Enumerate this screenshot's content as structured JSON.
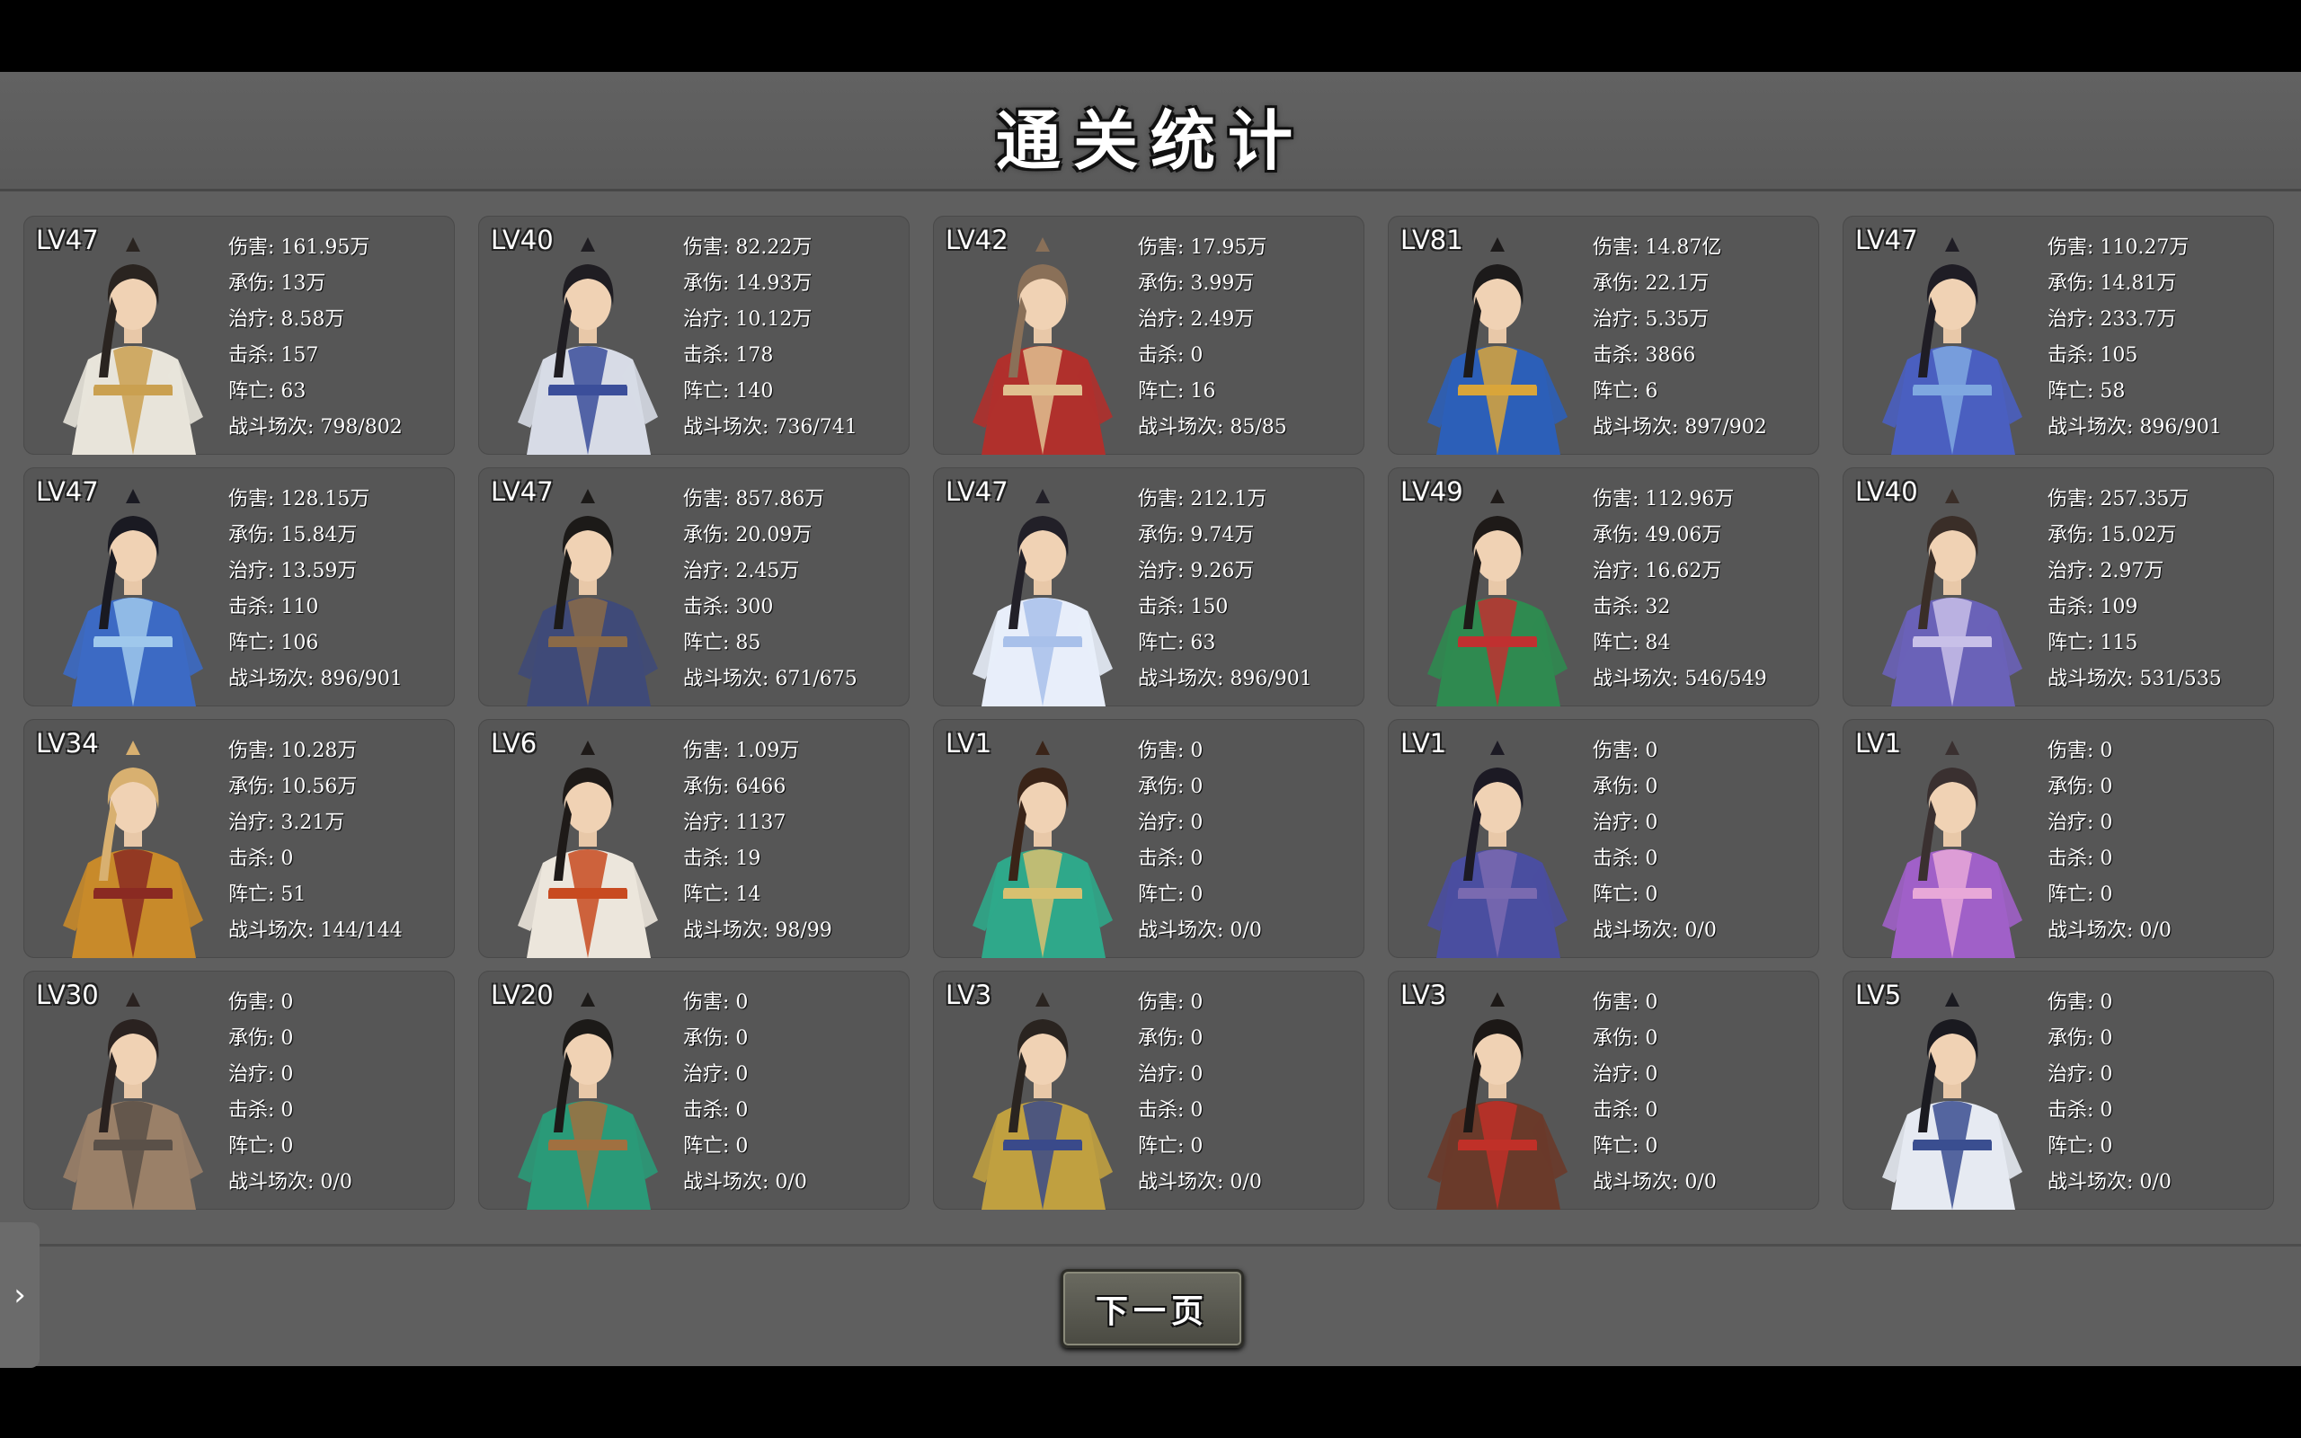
{
  "title": "通关统计",
  "next_page_label": "下一页",
  "side_tab_glyph": "›",
  "stat_labels": [
    "伤害",
    "承伤",
    "治疗",
    "击杀",
    "阵亡",
    "战斗场次"
  ],
  "cards": [
    {
      "level": "LV47",
      "stats": [
        "伤害: 161.95万",
        "承伤: 13万",
        "治疗: 8.58万",
        "击杀: 157",
        "阵亡: 63",
        "战斗场次: 798/802"
      ],
      "palette": {
        "robe": "#e8e4da",
        "accent": "#caa050",
        "hair": "#2a2420"
      }
    },
    {
      "level": "LV40",
      "stats": [
        "伤害: 82.22万",
        "承伤: 14.93万",
        "治疗: 10.12万",
        "击杀: 178",
        "阵亡: 140",
        "战斗场次: 736/741"
      ],
      "palette": {
        "robe": "#d7dbe6",
        "accent": "#3b4e9a",
        "hair": "#1f1d22"
      }
    },
    {
      "level": "LV42",
      "stats": [
        "伤害: 17.95万",
        "承伤: 3.99万",
        "治疗: 2.49万",
        "击杀: 0",
        "阵亡: 16",
        "战斗场次: 85/85"
      ],
      "palette": {
        "robe": "#b0302c",
        "accent": "#e0c090",
        "hair": "#8a7058"
      }
    },
    {
      "level": "LV81",
      "stats": [
        "伤害: 14.87亿",
        "承伤: 22.1万",
        "治疗: 5.35万",
        "击杀: 3866",
        "阵亡: 6",
        "战斗场次: 897/902"
      ],
      "palette": {
        "robe": "#2c5fb8",
        "accent": "#d9a53a",
        "hair": "#1c1a1a"
      }
    },
    {
      "level": "LV47",
      "stats": [
        "伤害: 110.27万",
        "承伤: 14.81万",
        "治疗: 233.7万",
        "击杀: 105",
        "阵亡: 58",
        "战斗场次: 896/901"
      ],
      "palette": {
        "robe": "#4a5fc0",
        "accent": "#7fa8e0",
        "hair": "#1f1d25"
      }
    },
    {
      "level": "LV47",
      "stats": [
        "伤害: 128.15万",
        "承伤: 15.84万",
        "治疗: 13.59万",
        "击杀: 110",
        "阵亡: 106",
        "战斗场次: 896/901"
      ],
      "palette": {
        "robe": "#3c6ac4",
        "accent": "#9fc8ec",
        "hair": "#1a1a22"
      }
    },
    {
      "level": "LV47",
      "stats": [
        "伤害: 857.86万",
        "承伤: 20.09万",
        "治疗: 2.45万",
        "击杀: 300",
        "阵亡: 85",
        "战斗场次: 671/675"
      ],
      "palette": {
        "robe": "#3f4a78",
        "accent": "#8a6a48",
        "hair": "#1c1a18"
      }
    },
    {
      "level": "LV47",
      "stats": [
        "伤害: 212.1万",
        "承伤: 9.74万",
        "治疗: 9.26万",
        "击杀: 150",
        "阵亡: 63",
        "战斗场次: 896/901"
      ],
      "palette": {
        "robe": "#e8eefa",
        "accent": "#a8c0ea",
        "hair": "#222028"
      }
    },
    {
      "level": "LV49",
      "stats": [
        "伤害: 112.96万",
        "承伤: 49.06万",
        "治疗: 16.62万",
        "击杀: 32",
        "阵亡: 84",
        "战斗场次: 546/549"
      ],
      "palette": {
        "robe": "#2f8a50",
        "accent": "#c03030",
        "hair": "#1e1a18"
      }
    },
    {
      "level": "LV40",
      "stats": [
        "伤害: 257.35万",
        "承伤: 15.02万",
        "治疗: 2.97万",
        "击杀: 109",
        "阵亡: 115",
        "战斗场次: 531/535"
      ],
      "palette": {
        "robe": "#6a62b8",
        "accent": "#c8c0e8",
        "hair": "#3a2e28"
      }
    },
    {
      "level": "LV34",
      "stats": [
        "伤害: 10.28万",
        "承伤: 10.56万",
        "治疗: 3.21万",
        "击杀: 0",
        "阵亡: 51",
        "战斗场次: 144/144"
      ],
      "palette": {
        "robe": "#c88a2a",
        "accent": "#8a2a22",
        "hair": "#d8b070"
      }
    },
    {
      "level": "LV6",
      "stats": [
        "伤害: 1.09万",
        "承伤: 6466",
        "治疗: 1137",
        "击杀: 19",
        "阵亡: 14",
        "战斗场次: 98/99"
      ],
      "palette": {
        "robe": "#ece6dc",
        "accent": "#c84a20",
        "hair": "#1e1a18"
      }
    },
    {
      "level": "LV1",
      "stats": [
        "伤害: 0",
        "承伤: 0",
        "治疗: 0",
        "击杀: 0",
        "阵亡: 0",
        "战斗场次: 0/0"
      ],
      "palette": {
        "robe": "#2fa88a",
        "accent": "#d8c070",
        "hair": "#3a2418"
      }
    },
    {
      "level": "LV1",
      "stats": [
        "伤害: 0",
        "承伤: 0",
        "治疗: 0",
        "击杀: 0",
        "阵亡: 0",
        "战斗场次: 0/0"
      ],
      "palette": {
        "robe": "#4a4ea0",
        "accent": "#7a6ab0",
        "hair": "#1c1a24"
      }
    },
    {
      "level": "LV1",
      "stats": [
        "伤害: 0",
        "承伤: 0",
        "治疗: 0",
        "击杀: 0",
        "阵亡: 0",
        "战斗场次: 0/0"
      ],
      "palette": {
        "robe": "#a060c8",
        "accent": "#e8a8d8",
        "hair": "#3a3030"
      }
    },
    {
      "level": "LV30",
      "stats": [
        "伤害: 0",
        "承伤: 0",
        "治疗: 0",
        "击杀: 0",
        "阵亡: 0",
        "战斗场次: 0/0"
      ],
      "palette": {
        "robe": "#9a8068",
        "accent": "#5a5048",
        "hair": "#2a2220"
      }
    },
    {
      "level": "LV20",
      "stats": [
        "伤害: 0",
        "承伤: 0",
        "治疗: 0",
        "击杀: 0",
        "阵亡: 0",
        "战斗场次: 0/0"
      ],
      "palette": {
        "robe": "#2a9a78",
        "accent": "#a07040",
        "hair": "#1c1a18"
      }
    },
    {
      "level": "LV3",
      "stats": [
        "伤害: 0",
        "承伤: 0",
        "治疗: 0",
        "击杀: 0",
        "阵亡: 0",
        "战斗场次: 0/0"
      ],
      "palette": {
        "robe": "#c0a040",
        "accent": "#3a4a8a",
        "hair": "#2a2420"
      }
    },
    {
      "level": "LV3",
      "stats": [
        "伤害: 0",
        "承伤: 0",
        "治疗: 0",
        "击杀: 0",
        "阵亡: 0",
        "战斗场次: 0/0"
      ],
      "palette": {
        "robe": "#6a3a2a",
        "accent": "#c03028",
        "hair": "#1c1816"
      }
    },
    {
      "level": "LV5",
      "stats": [
        "伤害: 0",
        "承伤: 0",
        "治疗: 0",
        "击杀: 0",
        "阵亡: 0",
        "战斗场次: 0/0"
      ],
      "palette": {
        "robe": "#e6eaf2",
        "accent": "#3a4e90",
        "hair": "#1a1a20"
      }
    }
  ]
}
